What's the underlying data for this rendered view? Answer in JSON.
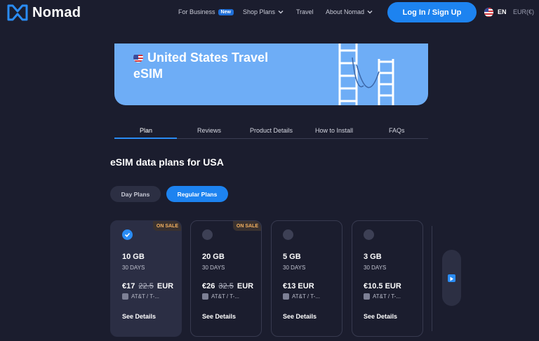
{
  "header": {
    "logo_text": "Nomad",
    "nav": {
      "for_business": "For Business",
      "new_badge": "New",
      "shop_plans": "Shop Plans",
      "travel": "Travel",
      "about": "About Nomad"
    },
    "login_label": "Log In / Sign Up",
    "language": "EN",
    "currency": "EUR(€)"
  },
  "banner": {
    "title_line1": "United States Travel",
    "title_line2": "eSIM",
    "flag_icon": "us-flag-icon"
  },
  "tabs": [
    "Plan",
    "Reviews",
    "Product Details",
    "How to Install",
    "FAQs"
  ],
  "active_tab": "Plan",
  "section_title": "eSIM data plans for USA",
  "plan_types": {
    "day": "Day Plans",
    "regular": "Regular Plans",
    "selected": "Regular Plans"
  },
  "plans": [
    {
      "data": "10 GB",
      "days": "30 DAYS",
      "price": "€17",
      "old_price": "22.5",
      "currency": "EUR",
      "carrier": "AT&T / T-...",
      "sale": "ON SALE",
      "selected": true,
      "cta": "See Details"
    },
    {
      "data": "20 GB",
      "days": "30 DAYS",
      "price": "€26",
      "old_price": "32.5",
      "currency": "EUR",
      "carrier": "AT&T / T-...",
      "sale": "ON SALE",
      "selected": false,
      "cta": "See Details"
    },
    {
      "data": "5 GB",
      "days": "30 DAYS",
      "price": "€13",
      "old_price": "",
      "currency": "EUR",
      "carrier": "AT&T / T-...",
      "sale": "",
      "selected": false,
      "cta": "See Details"
    },
    {
      "data": "3 GB",
      "days": "30 DAYS",
      "price": "€10.5",
      "old_price": "",
      "currency": "EUR",
      "carrier": "AT&T / T-...",
      "sale": "",
      "selected": false,
      "cta": "See Details"
    }
  ],
  "colors": {
    "background": "#1b1d2e",
    "accent": "#1d83f0",
    "banner": "#6eadf6",
    "sale_text": "#f4b160"
  }
}
